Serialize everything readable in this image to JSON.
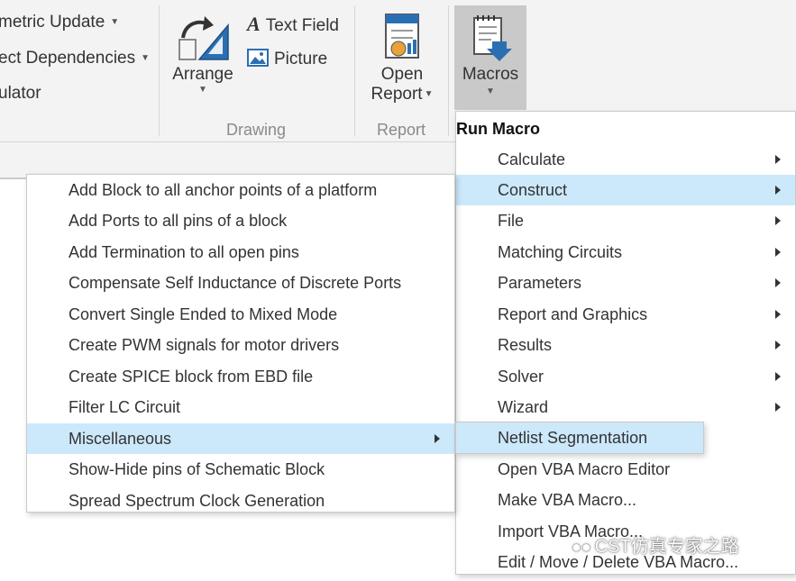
{
  "ribbon": {
    "left_items": [
      "metric Update",
      "ect Dependencies",
      "ulator"
    ],
    "arrange_label": "Arrange",
    "text_field_label": "Text Field",
    "picture_label": "Picture",
    "drawing_group": "Drawing",
    "open_report_line1": "Open",
    "open_report_line2": "Report",
    "report_group": "Report",
    "macros_label": "Macros"
  },
  "run_macro_menu": {
    "header": "Run Macro",
    "items": [
      {
        "label": "Calculate",
        "submenu": true
      },
      {
        "label": "Construct",
        "submenu": true,
        "highlighted": true
      },
      {
        "label": "File",
        "submenu": true
      },
      {
        "label": "Matching Circuits",
        "submenu": true
      },
      {
        "label": "Parameters",
        "submenu": true
      },
      {
        "label": "Report and Graphics",
        "submenu": true
      },
      {
        "label": "Results",
        "submenu": true
      },
      {
        "label": "Solver",
        "submenu": true
      },
      {
        "label": "Wizard",
        "submenu": true
      },
      {
        "label": "Open VBA Macro Editor",
        "submenu": false
      },
      {
        "label": "Make VBA Macro...",
        "submenu": false
      },
      {
        "label": "Import VBA Macro...",
        "submenu": false
      },
      {
        "label": "Edit / Move / Delete VBA Macro...",
        "submenu": false
      }
    ]
  },
  "construct_menu": {
    "items": [
      {
        "label": "Add Block to all anchor points of a platform"
      },
      {
        "label": "Add Ports to all pins of a block"
      },
      {
        "label": "Add Termination to all open pins"
      },
      {
        "label": "Compensate Self Inductance of Discrete Ports"
      },
      {
        "label": "Convert Single Ended to Mixed Mode"
      },
      {
        "label": "Create PWM signals for motor drivers"
      },
      {
        "label": "Create SPICE block from EBD file"
      },
      {
        "label": "Filter LC Circuit"
      },
      {
        "label": "Miscellaneous",
        "submenu": true,
        "highlighted": true
      },
      {
        "label": "Show-Hide pins of Schematic Block"
      },
      {
        "label": "Spread Spectrum Clock Generation"
      }
    ]
  },
  "misc_menu": {
    "items": [
      {
        "label": "Netlist Segmentation",
        "highlighted": true
      }
    ]
  },
  "watermark": "CST仿真专家之路",
  "colors": {
    "highlight": "#cce8fb",
    "ribbon_bg": "#f3f3f3",
    "macros_pressed": "#c9c9c9"
  }
}
